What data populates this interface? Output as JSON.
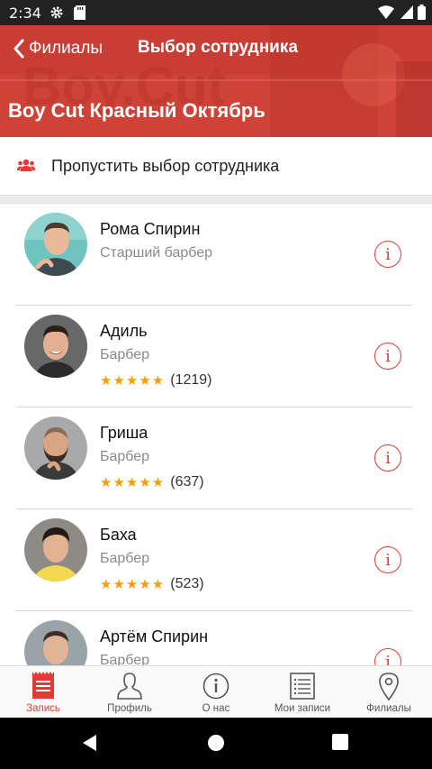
{
  "status_bar": {
    "time": "2:34"
  },
  "header": {
    "back_label": "Филиалы",
    "screen_title": "Выбор сотрудника",
    "branch_title": "Boy Cut Красный Октябрь"
  },
  "skip": {
    "label": "Пропустить выбор сотрудника",
    "icon": "group-icon"
  },
  "staff": [
    {
      "name": "Рома Спирин",
      "role": "Старший барбер",
      "rating": null,
      "reviews": null
    },
    {
      "name": "Адиль",
      "role": "Барбер",
      "rating": "★★★★★",
      "reviews": "(1219)"
    },
    {
      "name": "Гриша",
      "role": "Барбер",
      "rating": "★★★★★",
      "reviews": "(637)"
    },
    {
      "name": "Баха",
      "role": "Барбер",
      "rating": "★★★★★",
      "reviews": "(523)"
    },
    {
      "name": "Артём Спирин",
      "role": "Барбер",
      "rating": null,
      "reviews": null
    }
  ],
  "tabs": [
    {
      "label": "Запись",
      "icon": "booking-icon",
      "active": true
    },
    {
      "label": "Профиль",
      "icon": "profile-icon",
      "active": false
    },
    {
      "label": "О нас",
      "icon": "info-icon",
      "active": false
    },
    {
      "label": "Мои записи",
      "icon": "list-icon",
      "active": false
    },
    {
      "label": "Филиалы",
      "icon": "location-pin-icon",
      "active": false
    }
  ],
  "colors": {
    "accent": "#e53935",
    "header_red": "#d9473c",
    "star": "#f59e0b"
  }
}
